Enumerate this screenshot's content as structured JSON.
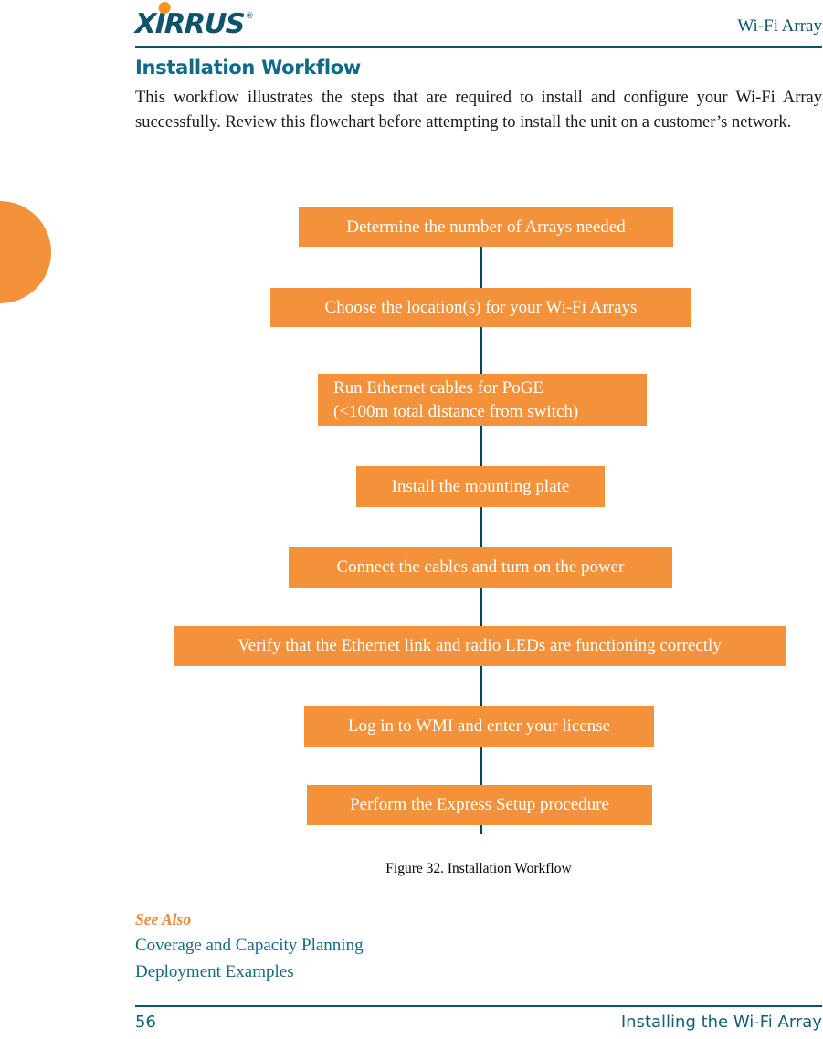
{
  "header": {
    "logo_text": "XIRRUS",
    "logo_registered_mark": "®",
    "logo_dot_icon": "orange-dot-icon",
    "title": "Wi-Fi Array"
  },
  "content": {
    "section_title": "Installation Workflow",
    "intro_paragraph": "This workflow illustrates the steps that are required to install and configure your Wi-Fi Array successfully. Review this flowchart before attempting to install the unit on a customer’s network."
  },
  "colors": {
    "accent_orange": "#f4923c",
    "brand_teal": "#0d5369",
    "link_teal": "#156a85",
    "heading_teal": "#106a86",
    "connector_line": "#0d4457",
    "box_text": "#ffffff"
  },
  "flowchart": {
    "type": "flowchart",
    "orientation": "vertical",
    "connector": "vertical-line",
    "steps": [
      {
        "index": 1,
        "label": "Determine the number of Arrays needed",
        "align": "center"
      },
      {
        "index": 2,
        "label": "Choose the location(s) for your Wi-Fi Arrays",
        "align": "center"
      },
      {
        "index": 3,
        "label": "Run Ethernet cables for PoGE",
        "label_line2": "(<100m total distance from switch)",
        "align": "left"
      },
      {
        "index": 4,
        "label": "Install the mounting plate",
        "align": "center"
      },
      {
        "index": 5,
        "label": "Connect the cables and turn on the power",
        "align": "center"
      },
      {
        "index": 6,
        "label": "Verify that the Ethernet link and radio LEDs are functioning correctly",
        "align": "center"
      },
      {
        "index": 7,
        "label": "Log in to WMI and enter your license",
        "align": "center"
      },
      {
        "index": 8,
        "label": "Perform the Express Setup procedure",
        "align": "center"
      }
    ]
  },
  "figure": {
    "caption": "Figure 32. Installation Workflow"
  },
  "see_also": {
    "heading": "See Also",
    "links": [
      "Coverage and Capacity Planning",
      "Deployment Examples"
    ]
  },
  "footer": {
    "page_number": "56",
    "section_title": "Installing the Wi-Fi Array"
  }
}
